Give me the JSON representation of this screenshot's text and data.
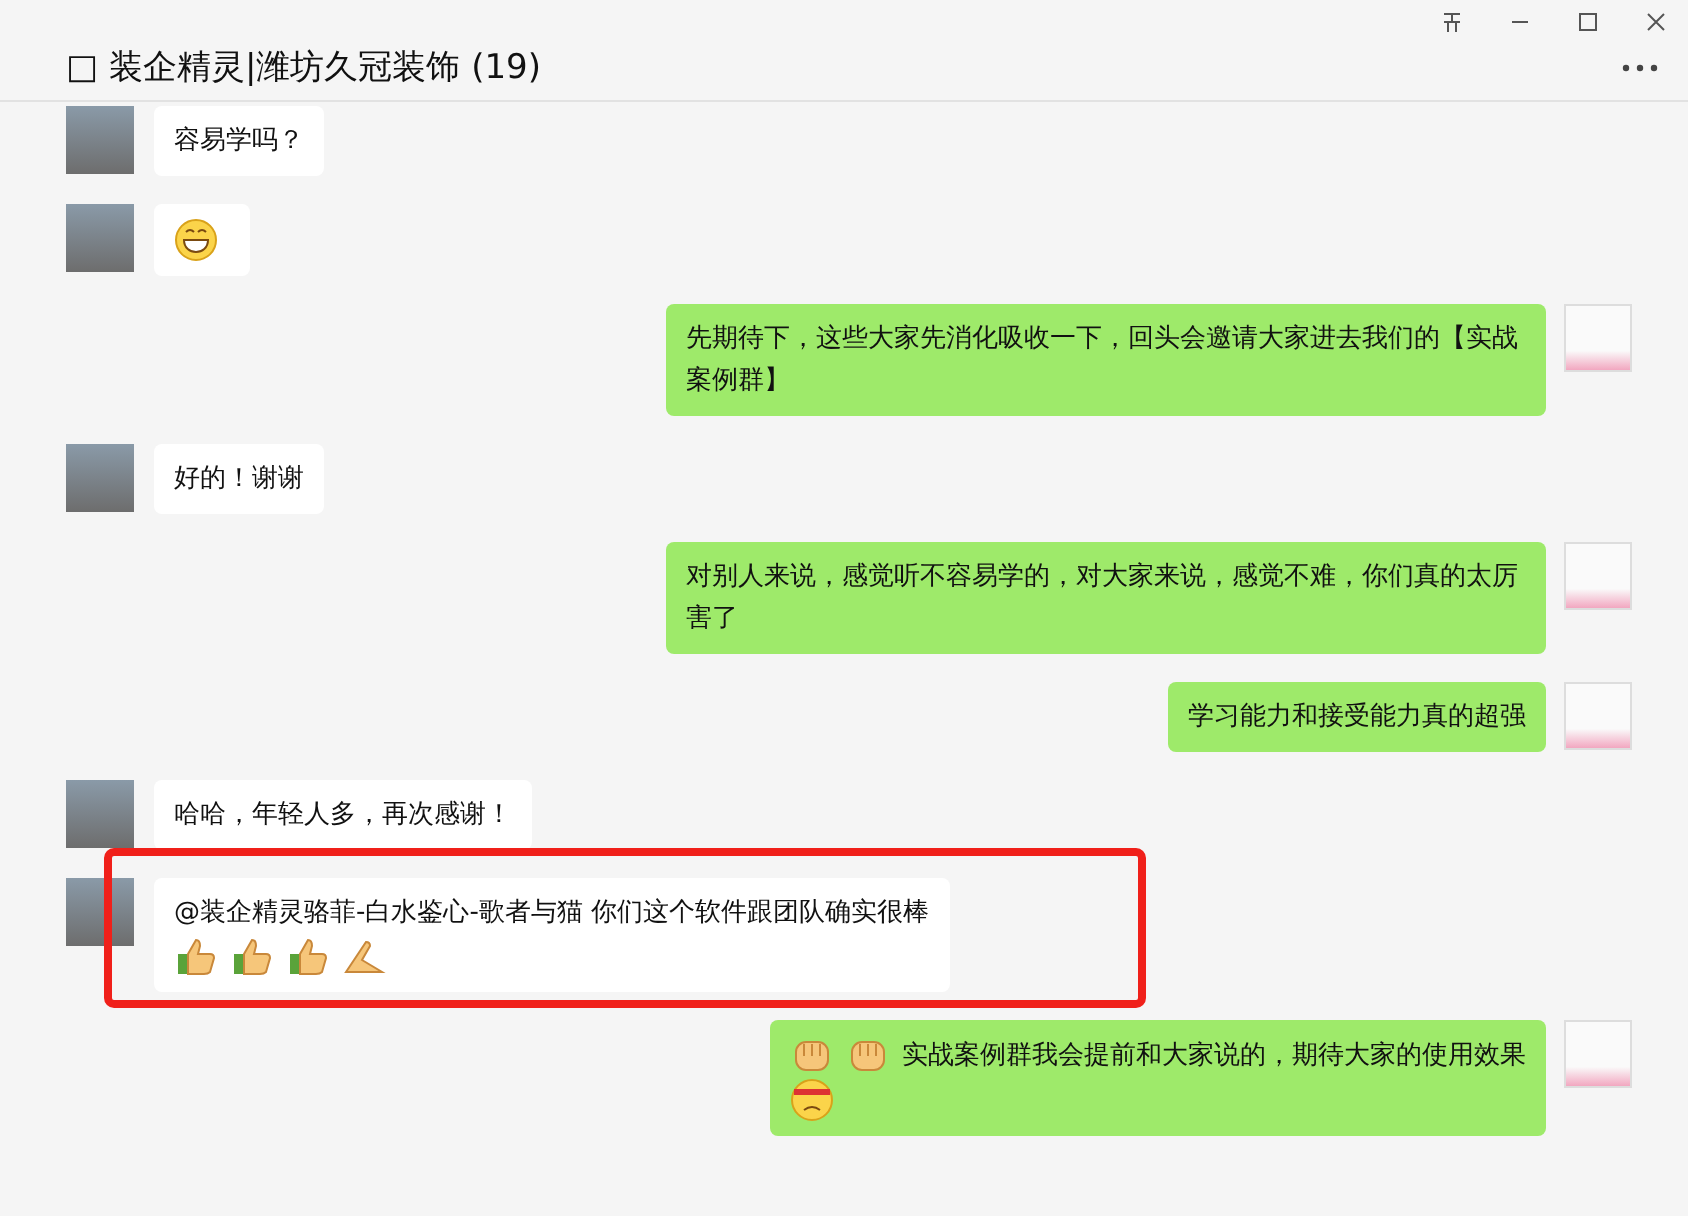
{
  "window": {
    "title": "□ 装企精灵|潍坊久冠装饰 (19)"
  },
  "messages": [
    {
      "outgoing": false,
      "highlighted": false,
      "parts": [
        {
          "kind": "text",
          "text": "容易学吗？"
        }
      ]
    },
    {
      "outgoing": false,
      "highlighted": false,
      "parts": [
        {
          "kind": "grin"
        }
      ]
    },
    {
      "outgoing": true,
      "highlighted": false,
      "parts": [
        {
          "kind": "text",
          "text": "先期待下，这些大家先消化吸收一下，回头会邀请大家进去我们的【实战案例群】"
        }
      ]
    },
    {
      "outgoing": false,
      "highlighted": false,
      "parts": [
        {
          "kind": "text",
          "text": "好的！谢谢"
        }
      ]
    },
    {
      "outgoing": true,
      "highlighted": false,
      "parts": [
        {
          "kind": "text",
          "text": "对别人来说，感觉听不容易学的，对大家来说，感觉不难，你们真的太厉害了"
        }
      ]
    },
    {
      "outgoing": true,
      "highlighted": false,
      "parts": [
        {
          "kind": "text",
          "text": "学习能力和接受能力真的超强"
        }
      ]
    },
    {
      "outgoing": false,
      "highlighted": false,
      "parts": [
        {
          "kind": "text",
          "text": "哈哈，年轻人多，再次感谢！"
        }
      ]
    },
    {
      "outgoing": false,
      "highlighted": true,
      "parts": [
        {
          "kind": "text",
          "text": "@装企精灵骆菲-白水鉴心-歌者与猫 你们这个软件跟团队确实很棒"
        },
        {
          "kind": "break"
        },
        {
          "kind": "thumbs-up"
        },
        {
          "kind": "thumbs-up"
        },
        {
          "kind": "thumbs-up"
        },
        {
          "kind": "hands"
        }
      ]
    },
    {
      "outgoing": true,
      "highlighted": false,
      "parts": [
        {
          "kind": "fist"
        },
        {
          "kind": "fist"
        },
        {
          "kind": "text",
          "text": "实战案例群我会提前和大家说的，期待大家的使用效果"
        },
        {
          "kind": "break"
        },
        {
          "kind": "headband-face"
        }
      ]
    }
  ]
}
